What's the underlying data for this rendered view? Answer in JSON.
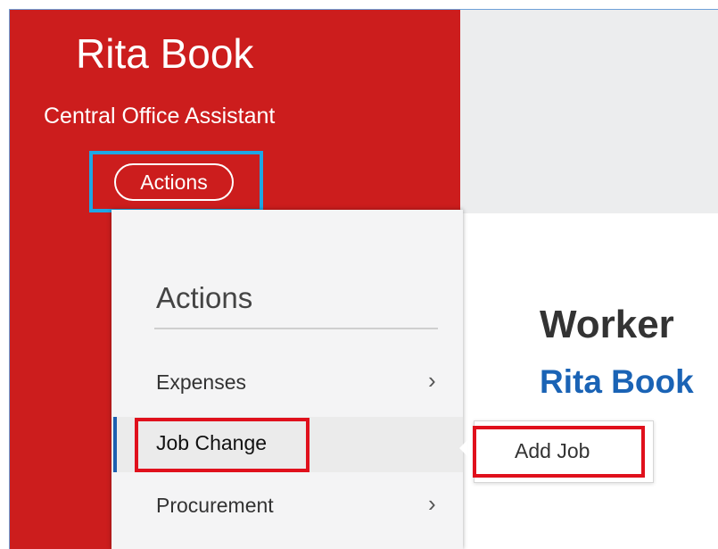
{
  "profile": {
    "name": "Rita Book",
    "title": "Central Office Assistant",
    "actions_button": "Actions"
  },
  "menu": {
    "heading": "Actions",
    "items": [
      {
        "label": "Expenses",
        "has_submenu": true
      },
      {
        "label": "Job Change",
        "selected": true
      },
      {
        "label": "Procurement",
        "has_submenu": true
      }
    ],
    "chevron": "›"
  },
  "submenu": {
    "items": [
      {
        "label": "Add Job"
      }
    ]
  },
  "worker": {
    "label": "Worker",
    "name": "Rita Book"
  },
  "colors": {
    "header_red": "#cc1d1d",
    "highlight_blue": "#1ea6e5",
    "highlight_red": "#e0101c",
    "link_blue": "#1a63b5",
    "selected_accent": "#1d5fb0"
  },
  "icons": {
    "submenu_indicator": "chevron-right-icon"
  }
}
